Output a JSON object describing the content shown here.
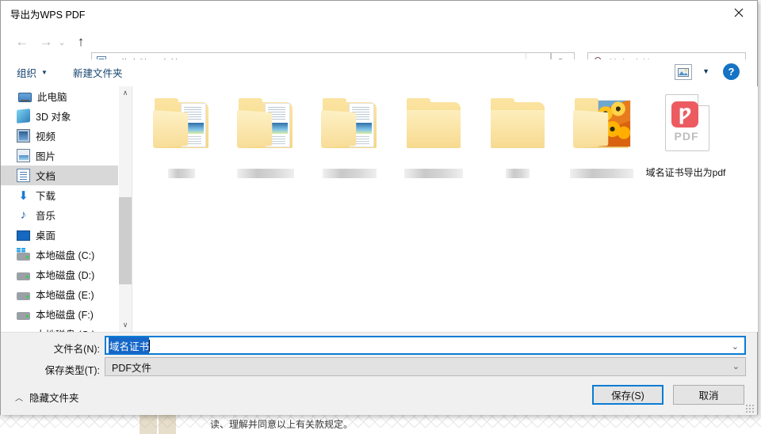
{
  "window": {
    "title": "导出为WPS PDF",
    "close_label": "×"
  },
  "nav": {
    "back_icon": "arrow-left-icon",
    "forward_icon": "arrow-right-icon",
    "recent_icon": "chevron-down-icon",
    "up_icon": "arrow-up-icon",
    "breadcrumbs": [
      "此电脑",
      "文档"
    ],
    "separator": "›",
    "dropdown_icon": "chevron-down-icon",
    "refresh_icon": "refresh-icon"
  },
  "search": {
    "placeholder": "搜索\"文档\"",
    "icon": "search-icon"
  },
  "commandbar": {
    "organize_label": "组织",
    "organize_caret": "▼",
    "new_folder_label": "新建文件夹",
    "view_icon": "view-mode-icon",
    "view_caret": "▼",
    "help_label": "?"
  },
  "sidebar": {
    "items": [
      {
        "label": "此电脑",
        "icon": "this-pc-icon",
        "selected": false,
        "root": true
      },
      {
        "label": "3D 对象",
        "icon": "3d-objects-icon",
        "selected": false,
        "root": false
      },
      {
        "label": "视频",
        "icon": "videos-icon",
        "selected": false,
        "root": false
      },
      {
        "label": "图片",
        "icon": "pictures-icon",
        "selected": false,
        "root": false
      },
      {
        "label": "文档",
        "icon": "documents-icon",
        "selected": true,
        "root": false
      },
      {
        "label": "下载",
        "icon": "downloads-icon",
        "selected": false,
        "root": false
      },
      {
        "label": "音乐",
        "icon": "music-icon",
        "selected": false,
        "root": false
      },
      {
        "label": "桌面",
        "icon": "desktop-icon",
        "selected": false,
        "root": false
      },
      {
        "label": "本地磁盘 (C:)",
        "icon": "system-drive-icon",
        "selected": false,
        "root": false
      },
      {
        "label": "本地磁盘 (D:)",
        "icon": "drive-icon",
        "selected": false,
        "root": false
      },
      {
        "label": "本地磁盘 (E:)",
        "icon": "drive-icon",
        "selected": false,
        "root": false
      },
      {
        "label": "本地磁盘 (F:)",
        "icon": "drive-icon",
        "selected": false,
        "root": false
      },
      {
        "label": "本地磁盘 (G:)",
        "icon": "drive-icon",
        "selected": false,
        "root": false
      }
    ],
    "scroll_up_icon": "chevron-up-icon",
    "scroll_down_icon": "chevron-down-icon"
  },
  "files": [
    {
      "kind": "folder-documents",
      "label": "",
      "redacted": true,
      "redact_width": 34
    },
    {
      "kind": "folder-documents",
      "label": "",
      "redacted": true,
      "redact_width": 72
    },
    {
      "kind": "folder-documents",
      "label": "",
      "redacted": true,
      "redact_width": 68
    },
    {
      "kind": "folder-empty",
      "label": "",
      "redacted": true,
      "redact_width": 74
    },
    {
      "kind": "folder-empty",
      "label": "",
      "redacted": true,
      "redact_width": 30
    },
    {
      "kind": "folder-pictures",
      "label": "",
      "redacted": true,
      "redact_width": 80
    },
    {
      "kind": "pdf-file",
      "label": "域名证书导出为pdf",
      "redacted": false,
      "redact_width": 0,
      "badge": "Ƿ",
      "badge_text": "PDF"
    }
  ],
  "form": {
    "filename_label": "文件名(N):",
    "filename_value": "域名证书",
    "filename_selected": true,
    "savetype_label": "保存类型(T):",
    "savetype_value": "PDF文件",
    "dropdown_icon": "chevron-down-icon",
    "hide_folders_label": "隐藏文件夹",
    "hide_folders_caret": "︿",
    "save_button": "保存(S)",
    "cancel_button": "取消"
  },
  "background": {
    "doc_text": "读、理解并同意以上有关款规定。"
  },
  "colors": {
    "accent": "#0a7cd4",
    "selection": "#1567c8",
    "command_text": "#14436e",
    "help_badge": "#1673c4",
    "folder": "#f6d684",
    "pdf_badge": "#ec5b60",
    "selected_row": "#d8d8d8"
  }
}
